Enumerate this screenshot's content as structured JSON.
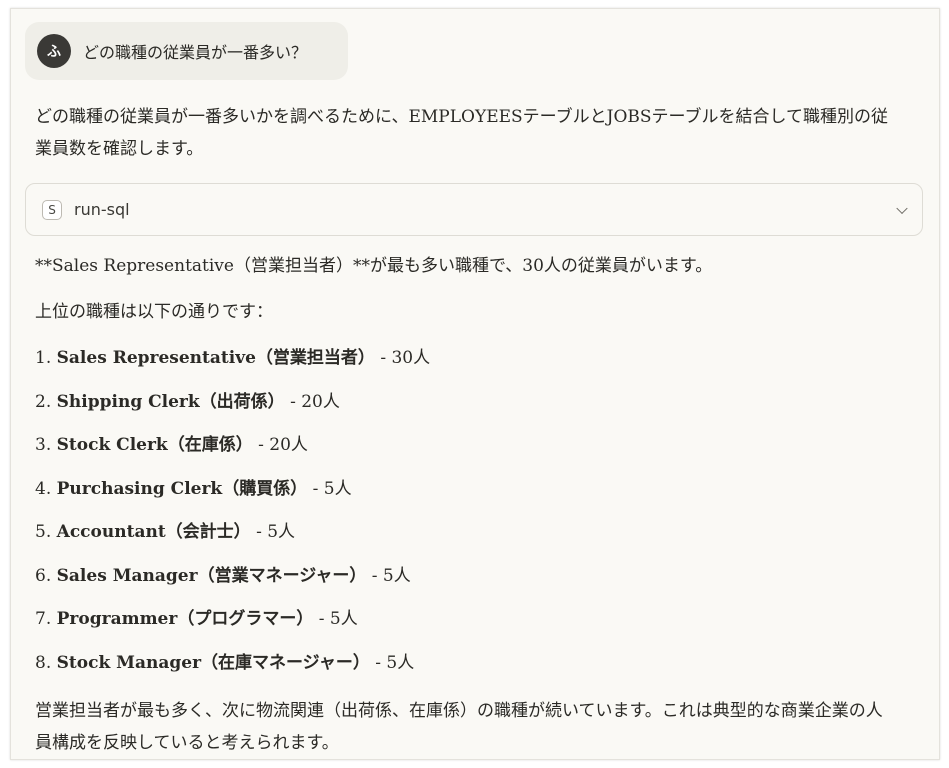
{
  "user_message": {
    "avatar_initial": "ふ",
    "text": "どの職種の従業員が一番多い？"
  },
  "assistant": {
    "intro": "どの職種の従業員が一番多いかを調べるために、EMPLOYEESテーブルとJOBSテーブルを結合して職種別の従業員数を確認します。",
    "tool_call": {
      "icon_letter": "S",
      "name": "run-sql",
      "icon": "chevron-down-icon"
    },
    "summary": "**Sales Representative（営業担当者）**が最も多い職種で、30人の従業員がいます。",
    "list_intro": "上位の職種は以下の通りです：",
    "jobs": [
      {
        "number": "1.",
        "name": "Sales Representative（営業担当者）",
        "count": " - 30人"
      },
      {
        "number": "2.",
        "name": "Shipping Clerk（出荷係）",
        "count": " - 20人"
      },
      {
        "number": "3.",
        "name": "Stock Clerk（在庫係）",
        "count": " - 20人"
      },
      {
        "number": "4.",
        "name": "Purchasing Clerk（購買係）",
        "count": " - 5人"
      },
      {
        "number": "5.",
        "name": "Accountant（会計士）",
        "count": " - 5人"
      },
      {
        "number": "6.",
        "name": "Sales Manager（営業マネージャー）",
        "count": " - 5人"
      },
      {
        "number": "7.",
        "name": "Programmer（プログラマー）",
        "count": " - 5人"
      },
      {
        "number": "8.",
        "name": "Stock Manager（在庫マネージャー）",
        "count": " - 5人"
      }
    ],
    "closing": "営業担当者が最も多く、次に物流関連（出荷係、在庫係）の職種が続いています。これは典型的な商業企業の人員構成を反映していると考えられます。"
  }
}
